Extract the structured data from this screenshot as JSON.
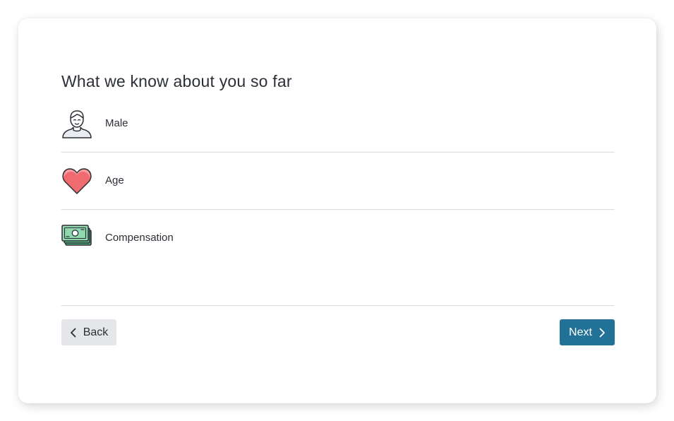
{
  "page": {
    "title": "What we know about you so far"
  },
  "facts": [
    {
      "label": "Male",
      "icon": "person-icon"
    },
    {
      "label": "Age",
      "icon": "heart-icon"
    },
    {
      "label": "Compensation",
      "icon": "money-icon"
    }
  ],
  "navigation": {
    "back_label": "Back",
    "next_label": "Next"
  },
  "colors": {
    "primary_button": "#227196",
    "secondary_button": "#e4e6e9",
    "heart_fill": "#ef6b6f",
    "money_fill": "#5fbf8c"
  }
}
